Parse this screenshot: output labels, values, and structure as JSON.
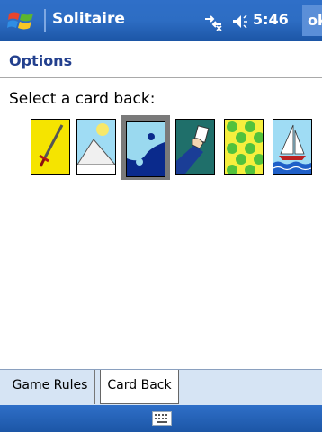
{
  "titlebar": {
    "app_title": "Solitaire",
    "clock": "5:46",
    "ok_label": "ok"
  },
  "header": {
    "title": "Options"
  },
  "prompt": "Select a card back:",
  "card_backs": [
    {
      "name": "sword",
      "selected": false
    },
    {
      "name": "mountain-sun",
      "selected": false
    },
    {
      "name": "yin-yang",
      "selected": true
    },
    {
      "name": "magician-hand",
      "selected": false
    },
    {
      "name": "clover-pattern",
      "selected": false
    },
    {
      "name": "sailboat",
      "selected": false
    }
  ],
  "tabs": [
    {
      "label": "Game Rules",
      "active": false
    },
    {
      "label": "Card Back",
      "active": true
    }
  ],
  "colors": {
    "titlebar": "#2d6dc3",
    "header_text": "#23408e",
    "tabbar": "#d6e4f4"
  },
  "icons": [
    "windows-start-icon",
    "connectivity-icon",
    "volume-icon",
    "keyboard-icon"
  ]
}
